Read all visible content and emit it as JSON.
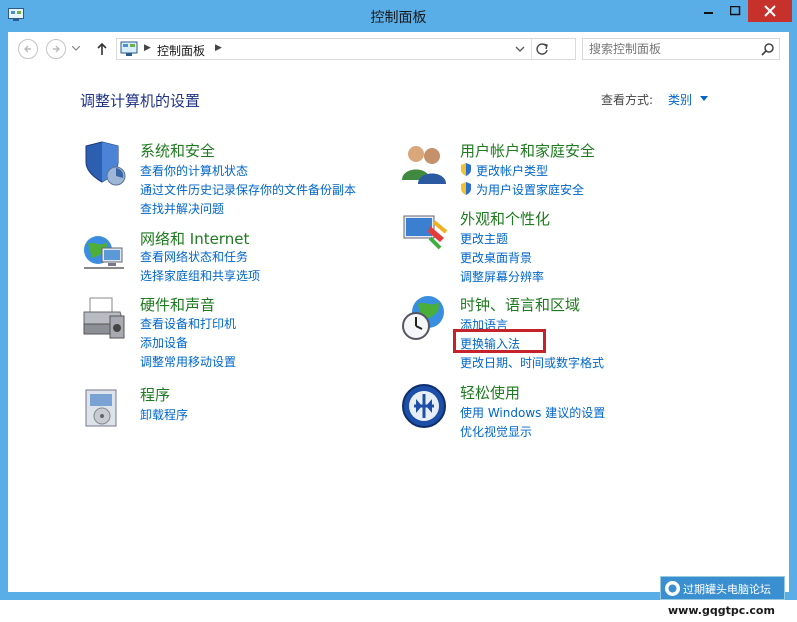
{
  "window": {
    "title": "控制面板"
  },
  "nav": {
    "address": "控制面板",
    "search_placeholder": "搜索控制面板"
  },
  "page": {
    "heading": "调整计算机的设置",
    "view_label": "查看方式:",
    "view_value": "类别"
  },
  "categories": {
    "system": {
      "title": "系统和安全",
      "links": [
        "查看你的计算机状态",
        "通过文件历史记录保存你的文件备份副本",
        "查找并解决问题"
      ]
    },
    "network": {
      "title": "网络和 Internet",
      "links": [
        "查看网络状态和任务",
        "选择家庭组和共享选项"
      ]
    },
    "hardware": {
      "title": "硬件和声音",
      "links": [
        "查看设备和打印机",
        "添加设备",
        "调整常用移动设置"
      ]
    },
    "programs": {
      "title": "程序",
      "links": [
        "卸载程序"
      ]
    },
    "user": {
      "title": "用户帐户和家庭安全",
      "links": [
        "更改帐户类型",
        "为用户设置家庭安全"
      ]
    },
    "appearance": {
      "title": "外观和个性化",
      "links": [
        "更改主题",
        "更改桌面背景",
        "调整屏幕分辨率"
      ]
    },
    "clock": {
      "title": "时钟、语言和区域",
      "links": [
        "添加语言",
        "更换输入法",
        "更改日期、时间或数字格式"
      ]
    },
    "ease": {
      "title": "轻松使用",
      "links": [
        "使用 Windows 建议的设置",
        "优化视觉显示"
      ]
    }
  },
  "watermark": {
    "text": "过期罐头电脑论坛",
    "url": "www.gqgtpc.com"
  },
  "colors": {
    "title_bar": "#5aaee8",
    "close_button": "#c7312b",
    "link": "#0066cc",
    "category_title": "#1e7a1e",
    "heading": "#1e3287",
    "highlight": "#c4232b"
  }
}
